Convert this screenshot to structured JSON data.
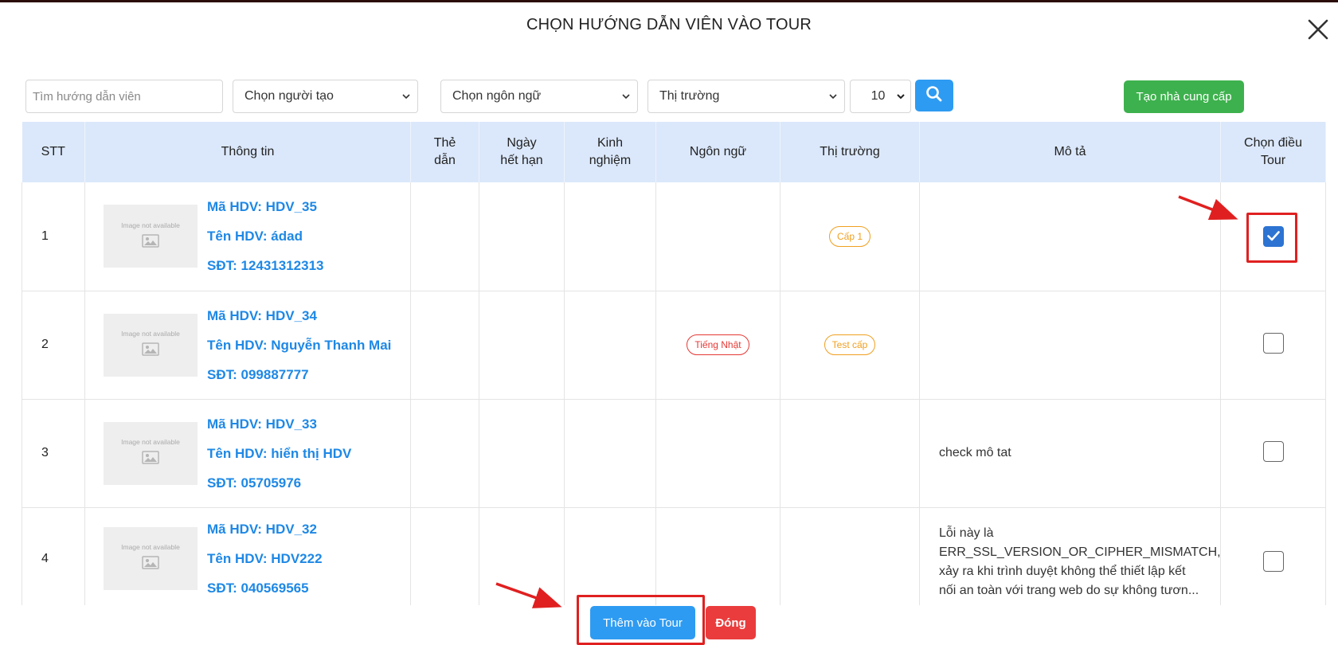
{
  "modal": {
    "title": "CHỌN HƯỚNG DẪN VIÊN VÀO TOUR"
  },
  "filters": {
    "search_placeholder": "Tìm hướng dẫn viên",
    "creator_label": "Chọn người tạo",
    "language_label": "Chọn ngôn ngữ",
    "market_label": "Thị trường",
    "page_size": "10"
  },
  "toolbar": {
    "create_supplier_label": "Tạo nhà cung cấp"
  },
  "table": {
    "headers": {
      "stt": "STT",
      "info": "Thông tin",
      "card": "Thẻ dẫn",
      "expiry": "Ngày hết hạn",
      "experience": "Kinh nghiệm",
      "language": "Ngôn ngữ",
      "market": "Thị trường",
      "description": "Mô tả",
      "select": "Chọn điều Tour"
    },
    "image_placeholder": "Image not available",
    "rows": [
      {
        "stt": "1",
        "code": "Mã HDV: HDV_35",
        "name": "Tên HDV: ádad",
        "phone": "SĐT: 12431312313",
        "language": "",
        "market": "Cấp 1",
        "description": "",
        "selected": true
      },
      {
        "stt": "2",
        "code": "Mã HDV: HDV_34",
        "name": "Tên HDV: Nguyễn Thanh Mai",
        "phone": "SĐT: 099887777",
        "language": "Tiếng Nhật",
        "market": "Test cấp",
        "description": "",
        "selected": false
      },
      {
        "stt": "3",
        "code": "Mã HDV: HDV_33",
        "name": "Tên HDV: hiển thị HDV",
        "phone": "SĐT: 05705976",
        "language": "",
        "market": "",
        "description": "check mô tat",
        "selected": false
      },
      {
        "stt": "4",
        "code": "Mã HDV: HDV_32",
        "name": "Tên HDV: HDV222",
        "phone": "SĐT: 040569565",
        "language": "",
        "market": "",
        "description": "Lỗi này là ERR_SSL_VERSION_OR_CIPHER_MISMATCH, xảy ra khi trình duyệt không thể thiết lập kết nối an toàn với trang web do sự không tươn...",
        "selected": false
      }
    ]
  },
  "footer": {
    "add_label": "Thêm vào Tour",
    "close_label": "Đóng"
  },
  "colors": {
    "primary": "#2e9bf2",
    "success": "#3db14d",
    "danger": "#ea3c3c",
    "header_bg": "#dbe8fb",
    "link_blue": "#1e88e5",
    "tag_orange": "#f0a020",
    "tag_red": "#e53935",
    "annotation_red": "#e02020"
  }
}
